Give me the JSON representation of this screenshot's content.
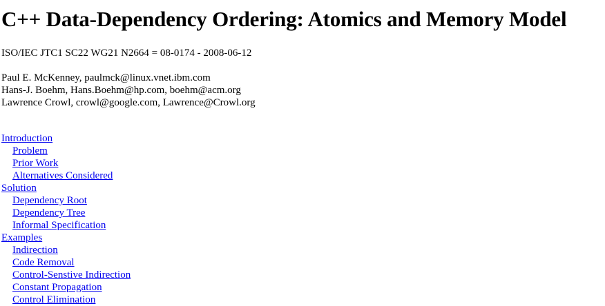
{
  "document": {
    "title": "C++ Data-Dependency Ordering: Atomics and Memory Model",
    "doc_number": "ISO/IEC JTC1 SC22 WG21 N2664 = 08-0174 - 2008-06-12",
    "authors": [
      "Paul E. McKenney, paulmck@linux.vnet.ibm.com",
      "Hans-J. Boehm, Hans.Boehm@hp.com, boehm@acm.org",
      "Lawrence Crowl, crowl@google.com, Lawrence@Crowl.org"
    ]
  },
  "toc": [
    {
      "label": "Introduction",
      "level": 1
    },
    {
      "label": "Problem",
      "level": 2
    },
    {
      "label": "Prior Work",
      "level": 2
    },
    {
      "label": "Alternatives Considered",
      "level": 2
    },
    {
      "label": "Solution",
      "level": 1
    },
    {
      "label": "Dependency Root",
      "level": 2
    },
    {
      "label": "Dependency Tree",
      "level": 2
    },
    {
      "label": "Informal Specification",
      "level": 2
    },
    {
      "label": "Examples",
      "level": 1
    },
    {
      "label": "Indirection",
      "level": 2
    },
    {
      "label": "Code Removal",
      "level": 2
    },
    {
      "label": "Control-Senstive Indirection",
      "level": 2
    },
    {
      "label": "Constant Propagation",
      "level": 2
    },
    {
      "label": "Control Elimination",
      "level": 2
    }
  ],
  "colors": {
    "link": "#0000ee",
    "text": "#000000",
    "background": "#ffffff"
  }
}
